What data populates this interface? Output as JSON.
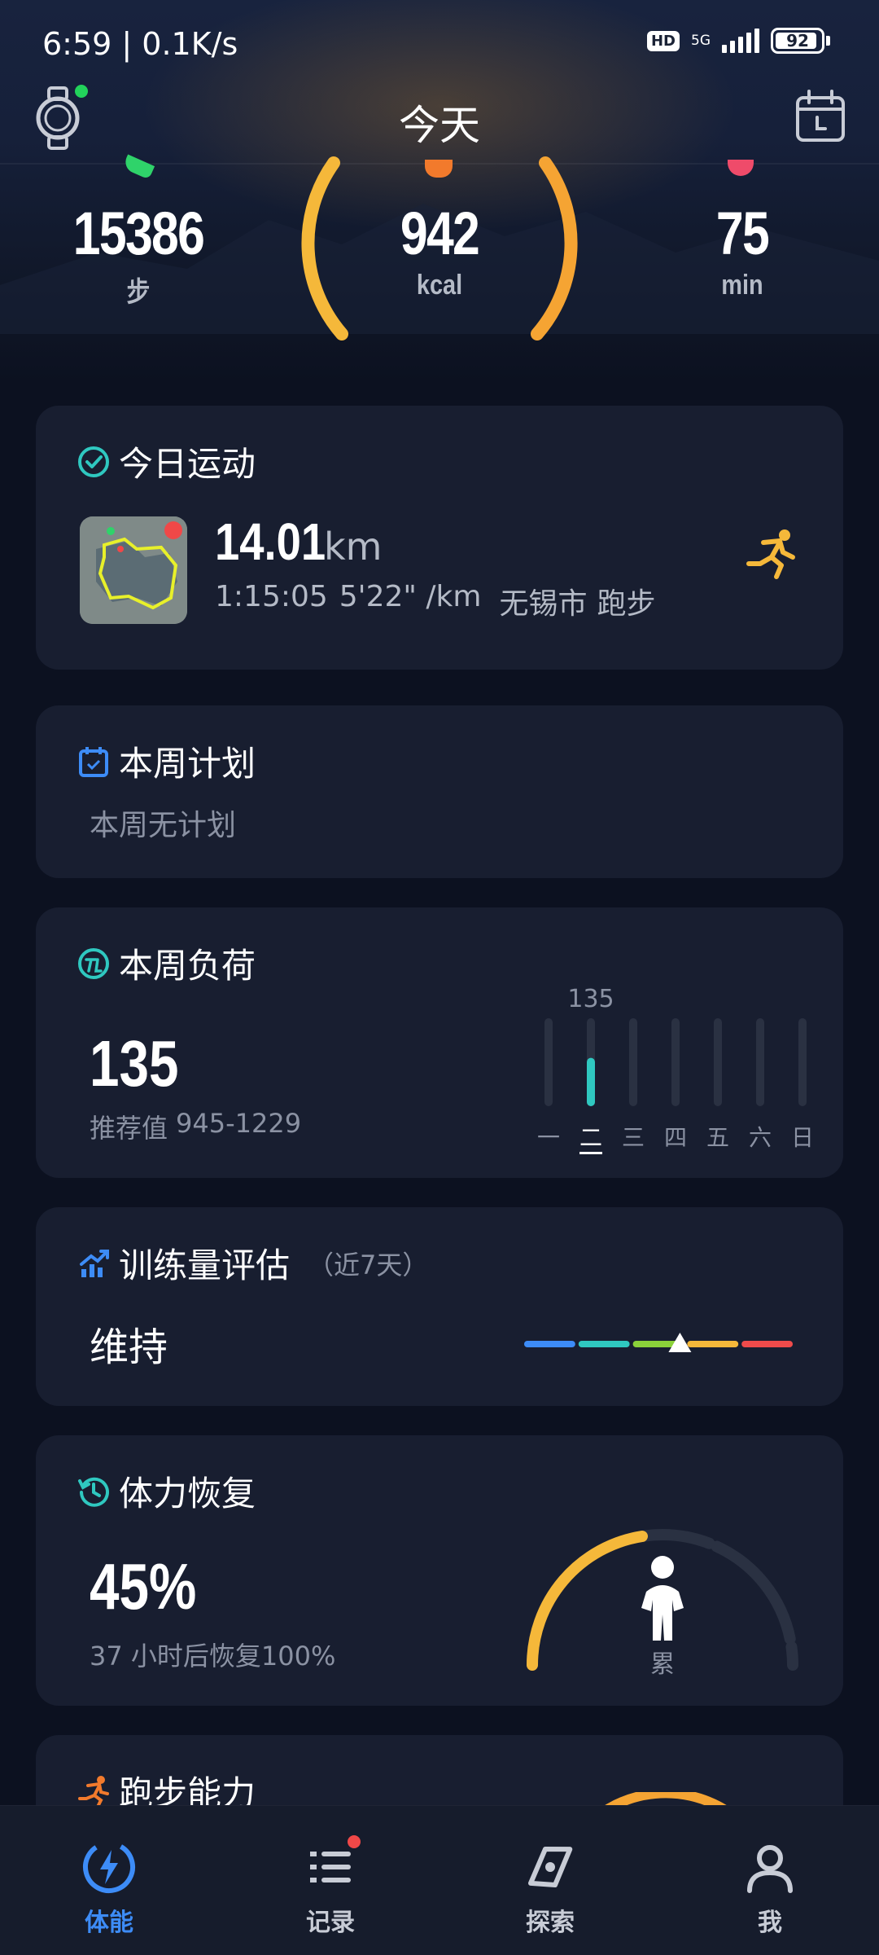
{
  "status_bar": {
    "time_speed": "6:59 | 0.1K/s",
    "hd": "HD",
    "network": "5G",
    "battery": "92",
    "battery_level": 0.92
  },
  "header": {
    "title": "今天"
  },
  "hero": {
    "steps": {
      "value": "15386",
      "unit": "步"
    },
    "calories": {
      "value": "942",
      "unit": "kcal"
    },
    "minutes": {
      "value": "75",
      "unit": "min"
    }
  },
  "today_activity": {
    "title": "今日运动",
    "distance": "14.01",
    "distance_unit": "km",
    "duration": "1:15:05",
    "pace": "5'22\" /km",
    "city": "无锡市",
    "sport": "跑步"
  },
  "weekly_plan": {
    "title": "本周计划",
    "empty_text": "本周无计划"
  },
  "weekly_load": {
    "title": "本周负荷",
    "value": "135",
    "recommended_label": "推荐值",
    "recommended_range": "945-1229",
    "peak_label": "135",
    "days": [
      "一",
      "二",
      "三",
      "四",
      "五",
      "六",
      "日"
    ],
    "day_values": [
      0,
      135,
      0,
      0,
      0,
      0,
      0
    ],
    "current_day_index": 1,
    "accent": "#2fc8c0"
  },
  "training_eval": {
    "title": "训练量评估",
    "subtitle": "（近7天）",
    "status": "维持",
    "scale_colors": [
      "#3d8cf7",
      "#2fc8c0",
      "#8bd13a",
      "#f5b83a",
      "#ef4b4b"
    ],
    "marker_position_fraction": 0.58
  },
  "recovery": {
    "title": "体力恢复",
    "percent": "45%",
    "percent_value": 45,
    "note": "37 小时后恢复100%",
    "state": "累",
    "accent": "#f5b83a"
  },
  "running_ability": {
    "title": "跑步能力"
  },
  "tabs": [
    {
      "label": "体能",
      "icon": "bolt-icon",
      "active": true
    },
    {
      "label": "记录",
      "icon": "list-icon",
      "badge": true
    },
    {
      "label": "探索",
      "icon": "compass-icon"
    },
    {
      "label": "我",
      "icon": "person-icon"
    }
  ],
  "colors": {
    "accent_blue": "#3d8cf7",
    "ring_orange": "#f5b83a",
    "card_bg": "#181e30"
  }
}
